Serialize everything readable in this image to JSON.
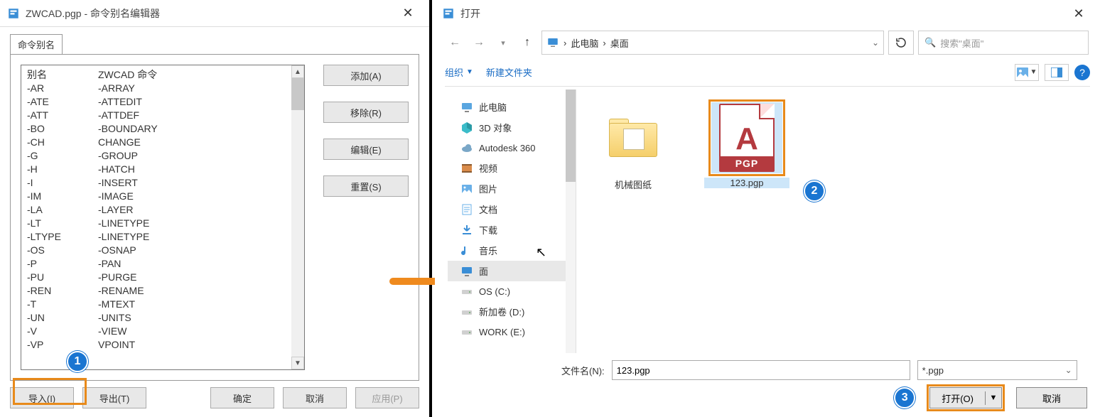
{
  "left": {
    "title": "ZWCAD.pgp - 命令别名编辑器",
    "tab_label": "命令别名",
    "columns": {
      "alias": "别名",
      "command": "ZWCAD 命令"
    },
    "rows": [
      {
        "a": "-AR",
        "c": "-ARRAY"
      },
      {
        "a": "-ATE",
        "c": "-ATTEDIT"
      },
      {
        "a": "-ATT",
        "c": "-ATTDEF"
      },
      {
        "a": "-BO",
        "c": "-BOUNDARY"
      },
      {
        "a": "-CH",
        "c": "CHANGE"
      },
      {
        "a": "-G",
        "c": "-GROUP"
      },
      {
        "a": "-H",
        "c": "-HATCH"
      },
      {
        "a": "-I",
        "c": "-INSERT"
      },
      {
        "a": "-IM",
        "c": "-IMAGE"
      },
      {
        "a": "-LA",
        "c": "-LAYER"
      },
      {
        "a": "-LT",
        "c": "-LINETYPE"
      },
      {
        "a": "-LTYPE",
        "c": "-LINETYPE"
      },
      {
        "a": "-OS",
        "c": "-OSNAP"
      },
      {
        "a": "-P",
        "c": "-PAN"
      },
      {
        "a": "-PU",
        "c": "-PURGE"
      },
      {
        "a": "-REN",
        "c": "-RENAME"
      },
      {
        "a": "-T",
        "c": "-MTEXT"
      },
      {
        "a": "-UN",
        "c": "-UNITS"
      },
      {
        "a": "-V",
        "c": "-VIEW"
      },
      {
        "a": "-VP",
        "c": "VPOINT"
      }
    ],
    "buttons": {
      "add": "添加(A)",
      "remove": "移除(R)",
      "edit": "编辑(E)",
      "reset": "重置(S)"
    },
    "bottom": {
      "import": "导入(I)",
      "export": "导出(T)",
      "ok": "确定",
      "cancel": "取消",
      "apply": "应用(P)"
    }
  },
  "right": {
    "title": "打开",
    "breadcrumbs": [
      "此电脑",
      "桌面"
    ],
    "search_placeholder": "搜索\"桌面\"",
    "toolbar": {
      "organize": "组织",
      "newfolder": "新建文件夹"
    },
    "tree": [
      {
        "icon": "pc",
        "label": "此电脑"
      },
      {
        "icon": "cube",
        "label": "3D 对象"
      },
      {
        "icon": "cloud",
        "label": "Autodesk 360"
      },
      {
        "icon": "video",
        "label": "视频"
      },
      {
        "icon": "picture",
        "label": "图片"
      },
      {
        "icon": "doc",
        "label": "文档"
      },
      {
        "icon": "download",
        "label": "下载"
      },
      {
        "icon": "music",
        "label": "音乐"
      },
      {
        "icon": "desktop",
        "label": "面",
        "sel": true
      },
      {
        "icon": "disk",
        "label": "OS (C:)"
      },
      {
        "icon": "disk",
        "label": "新加卷 (D:)"
      },
      {
        "icon": "disk",
        "label": "WORK (E:)"
      }
    ],
    "files": [
      {
        "kind": "folder",
        "label": "机械图纸"
      },
      {
        "kind": "pgp",
        "label": "123.pgp",
        "sel": true,
        "pgp_band": "PGP"
      }
    ],
    "filename_label": "文件名(N):",
    "filename_value": "123.pgp",
    "filter": "*.pgp",
    "open_btn": "打开(O)",
    "cancel_btn": "取消"
  },
  "callouts": {
    "one": "1",
    "two": "2",
    "three": "3"
  }
}
